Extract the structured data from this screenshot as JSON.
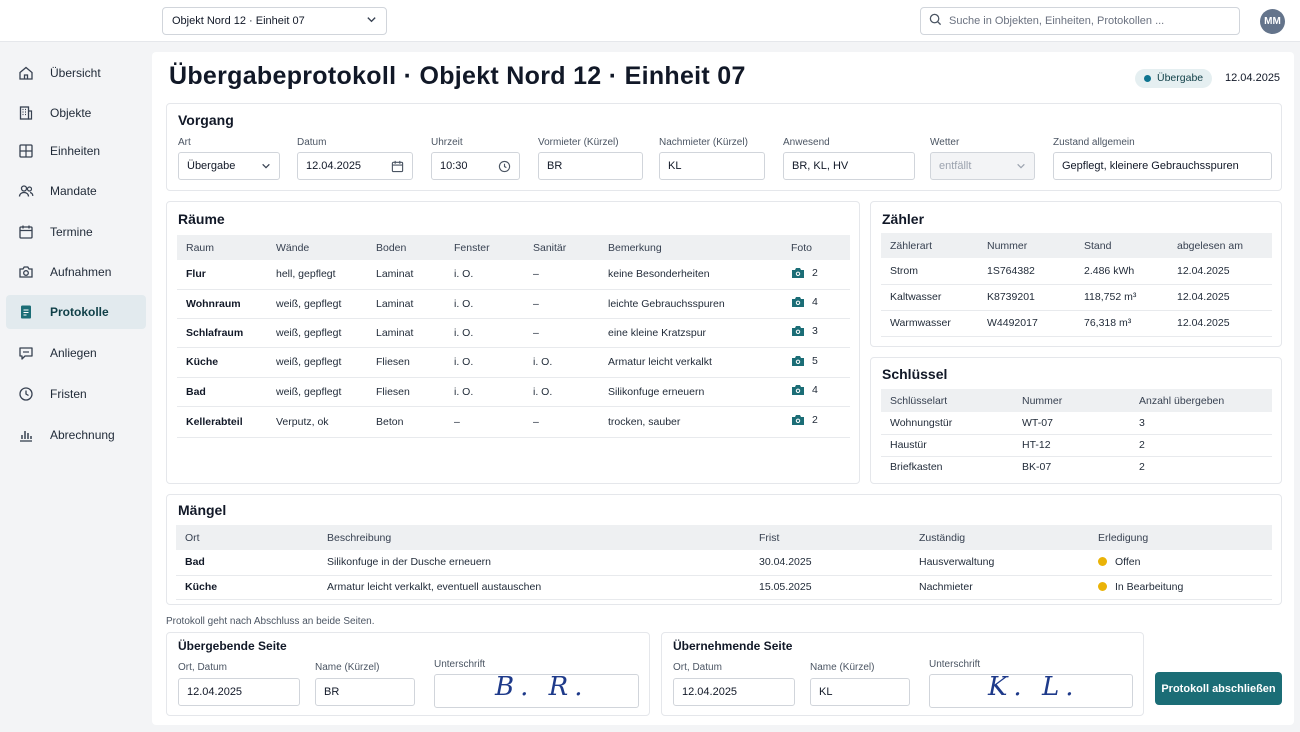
{
  "topbar": {
    "object_selector": "Objekt Nord 12 · Einheit 07",
    "search_placeholder": "Suche in Objekten, Einheiten, Protokollen ...",
    "avatar_initials": "MM"
  },
  "sidebar": {
    "items": [
      {
        "label": "Übersicht",
        "icon": "home-icon"
      },
      {
        "label": "Objekte",
        "icon": "building-icon"
      },
      {
        "label": "Einheiten",
        "icon": "units-icon"
      },
      {
        "label": "Mandate",
        "icon": "users-icon"
      },
      {
        "label": "Termine",
        "icon": "calendar-icon"
      },
      {
        "label": "Aufnahmen",
        "icon": "camera-icon"
      },
      {
        "label": "Protokolle",
        "icon": "document-icon",
        "active": true
      },
      {
        "label": "Anliegen",
        "icon": "chat-icon"
      },
      {
        "label": "Fristen",
        "icon": "clock-icon"
      },
      {
        "label": "Abrechnung",
        "icon": "chart-icon"
      }
    ]
  },
  "header": {
    "title": "Übergabeprotokoll · Objekt Nord 12 · Einheit 07",
    "status_badge": "Übergabe",
    "date": "12.04.2025"
  },
  "vorgang": {
    "title": "Vorgang",
    "fields": {
      "art": {
        "label": "Art",
        "value": "Übergabe"
      },
      "datum": {
        "label": "Datum",
        "value": "12.04.2025"
      },
      "uhrzeit": {
        "label": "Uhrzeit",
        "value": "10:30"
      },
      "vormieter": {
        "label": "Vormieter (Kürzel)",
        "value": "BR"
      },
      "nachmieter": {
        "label": "Nachmieter (Kürzel)",
        "value": "KL"
      },
      "anwesend": {
        "label": "Anwesend",
        "value": "BR, KL, HV"
      },
      "wetter": {
        "label": "Wetter",
        "value": "entfällt"
      },
      "zustand": {
        "label": "Zustand allgemein",
        "value": "Gepflegt, kleinere Gebrauchsspuren"
      }
    }
  },
  "raeume": {
    "title": "Räume",
    "columns": [
      "Raum",
      "Wände",
      "Boden",
      "Fenster",
      "Sanitär",
      "Bemerkung",
      "Foto"
    ],
    "rows": [
      {
        "raum": "Flur",
        "waende": "hell, gepflegt",
        "boden": "Laminat",
        "fenster": "i. O.",
        "sanitaer": "–",
        "bemerkung": "keine Besonderheiten",
        "foto": "2"
      },
      {
        "raum": "Wohnraum",
        "waende": "weiß, gepflegt",
        "boden": "Laminat",
        "fenster": "i. O.",
        "sanitaer": "–",
        "bemerkung": "leichte Gebrauchsspuren",
        "foto": "4"
      },
      {
        "raum": "Schlafraum",
        "waende": "weiß, gepflegt",
        "boden": "Laminat",
        "fenster": "i. O.",
        "sanitaer": "–",
        "bemerkung": "eine kleine Kratzspur",
        "foto": "3"
      },
      {
        "raum": "Küche",
        "waende": "weiß, gepflegt",
        "boden": "Fliesen",
        "fenster": "i. O.",
        "sanitaer": "i. O.",
        "bemerkung": "Armatur leicht verkalkt",
        "foto": "5"
      },
      {
        "raum": "Bad",
        "waende": "weiß, gepflegt",
        "boden": "Fliesen",
        "fenster": "i. O.",
        "sanitaer": "i. O.",
        "bemerkung": "Silikonfuge erneuern",
        "foto": "4"
      },
      {
        "raum": "Kellerabteil",
        "waende": "Verputz, ok",
        "boden": "Beton",
        "fenster": "–",
        "sanitaer": "–",
        "bemerkung": "trocken, sauber",
        "foto": "2"
      }
    ]
  },
  "zaehler": {
    "title": "Zähler",
    "columns": [
      "Zählerart",
      "Nummer",
      "Stand",
      "abgelesen am"
    ],
    "rows": [
      {
        "art": "Strom",
        "nummer": "1S764382",
        "stand": "2.486 kWh",
        "datum": "12.04.2025"
      },
      {
        "art": "Kaltwasser",
        "nummer": "K8739201",
        "stand": "118,752 m³",
        "datum": "12.04.2025"
      },
      {
        "art": "Warmwasser",
        "nummer": "W4492017",
        "stand": "76,318 m³",
        "datum": "12.04.2025"
      }
    ]
  },
  "schluessel": {
    "title": "Schlüssel",
    "columns": [
      "Schlüsselart",
      "Nummer",
      "Anzahl übergeben"
    ],
    "rows": [
      {
        "art": "Wohnungstür",
        "nummer": "WT-07",
        "anzahl": "3"
      },
      {
        "art": "Haustür",
        "nummer": "HT-12",
        "anzahl": "2"
      },
      {
        "art": "Briefkasten",
        "nummer": "BK-07",
        "anzahl": "2"
      }
    ]
  },
  "maengel": {
    "title": "Mängel",
    "columns": [
      "Ort",
      "Beschreibung",
      "Frist",
      "Zuständig",
      "Erledigung"
    ],
    "rows": [
      {
        "ort": "Bad",
        "beschreibung": "Silikonfuge in der Dusche erneuern",
        "frist": "30.04.2025",
        "zustaendig": "Hausverwaltung",
        "erledigung": "Offen"
      },
      {
        "ort": "Küche",
        "beschreibung": "Armatur leicht verkalkt, eventuell austauschen",
        "frist": "15.05.2025",
        "zustaendig": "Nachmieter",
        "erledigung": "In Bearbeitung"
      }
    ]
  },
  "footer_note": "Protokoll geht nach Abschluss an beide Seiten.",
  "uebergebend": {
    "title": "Übergebende Seite",
    "ort_label": "Ort, Datum",
    "ort_value": "12.04.2025",
    "name_label": "Name (Kürzel)",
    "name_value": "BR",
    "sig_label": "Unterschrift",
    "signature": "B. R."
  },
  "uebernehmend": {
    "title": "Übernehmende Seite",
    "ort_label": "Ort, Datum",
    "ort_value": "12.04.2025",
    "name_label": "Name (Kürzel)",
    "name_value": "KL",
    "sig_label": "Unterschrift",
    "signature": "K. L."
  },
  "actions": {
    "finish_label": "Protokoll abschließen"
  },
  "colors": {
    "accent": "#1b6d76",
    "status_yellow": "#eab308",
    "active_nav_bg": "#e2eaee"
  }
}
